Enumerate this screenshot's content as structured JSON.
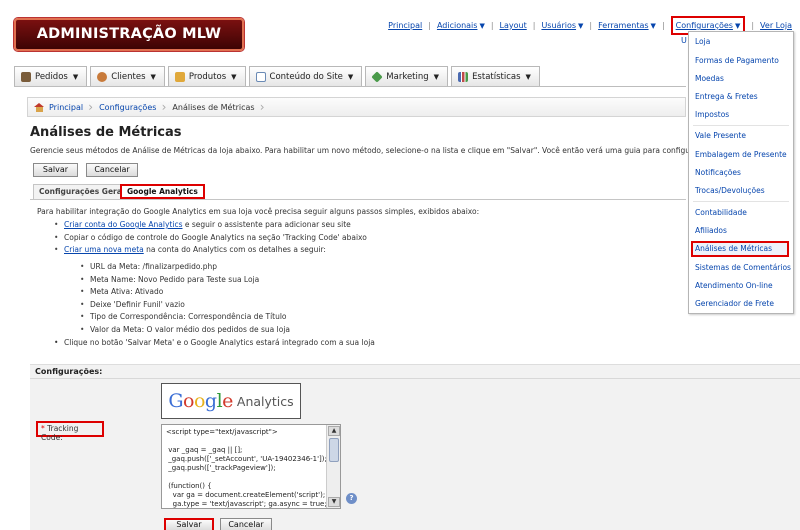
{
  "logo": {
    "text": "ADMINISTRAÇÃO MLW"
  },
  "top_links": [
    {
      "label": "Principal",
      "caret": false
    },
    {
      "label": "Adicionais",
      "caret": true
    },
    {
      "label": "Layout",
      "caret": false
    },
    {
      "label": "Usuários",
      "caret": true
    },
    {
      "label": "Ferramentas",
      "caret": true
    },
    {
      "label": "Configurações",
      "caret": true
    },
    {
      "label": "Ver Loja",
      "caret": false
    }
  ],
  "top_stub": "U",
  "menu_tabs": [
    {
      "label": "Pedidos",
      "icon": "pedidos-icon",
      "color": "#7a5c3a"
    },
    {
      "label": "Clientes",
      "icon": "clientes-icon",
      "color": "#c87a3a"
    },
    {
      "label": "Produtos",
      "icon": "produtos-icon",
      "color": "#e0a83a"
    },
    {
      "label": "Conteúdo do Site",
      "icon": "conteudo-icon",
      "color": "#6a8ab5"
    },
    {
      "label": "Marketing",
      "icon": "marketing-icon",
      "color": "#4a9a4a"
    },
    {
      "label": "Estatísticas",
      "icon": "estatisticas-icon",
      "color": "#4a6ab0"
    }
  ],
  "breadcrumb": [
    {
      "label": "Principal"
    },
    {
      "label": "Configurações"
    },
    {
      "label": "Análises de Métricas"
    }
  ],
  "page": {
    "title": "Análises de Métricas",
    "description": "Gerencie seus métodos de Análise de Métricas da loja abaixo. Para habilitar um novo método, selecione-o na lista e clique em \"Salvar\". Você então verá uma guia para configurá-lo.",
    "save_label": "Salvar",
    "cancel_label": "Cancelar"
  },
  "sub_tabs": [
    {
      "label": "Configurações Gerais"
    },
    {
      "label": "Google Analytics"
    }
  ],
  "instructions": {
    "intro": "Para habilitar integração do Google Analytics em sua loja você precisa seguir alguns passos simples, exibidos abaixo:",
    "step1_link": "Criar conta do Google Analytics",
    "step1_rest": " e seguir o assistente para adicionar seu site",
    "step2": "Copiar o código de controle do Google Analytics na seção 'Tracking Code' abaixo",
    "step3_link": "Criar uma nova meta",
    "step3_rest": " na conta do Analytics com os detalhes a seguir:",
    "details": [
      "URL da Meta: /finalizarpedido.php",
      "Meta Name: Novo Pedido para Teste sua Loja",
      "Meta Ativa: Ativado",
      "Deixe 'Definir Funil' vazio",
      "Tipo de Correspondência: Correspondência de Título",
      "Valor da Meta: O valor médio dos pedidos de sua loja"
    ],
    "final": "Clique no botão 'Salvar Meta' e o Google Analytics estará integrado com a sua loja"
  },
  "config": {
    "heading": "Configurações:",
    "logo_google": "Google",
    "logo_analytics": "Analytics",
    "tracking_label": "Tracking Code:",
    "required_mark": "*",
    "code": "<script type=\"text/javascript\">\n\n var _gaq = _gaq || [];\n _gaq.push(['_setAccount', 'UA-19402346-1']);\n _gaq.push(['_trackPageview']);\n\n (function() {\n   var ga = document.createElement('script');\n   ga.type = 'text/javascript'; ga.async = true;",
    "help": "?",
    "save_label": "Salvar",
    "cancel_label": "Cancelar"
  },
  "dropdown": {
    "items": [
      "Loja",
      "Formas de Pagamento",
      "Moedas",
      "Entrega & Fretes",
      "Impostos",
      "Vale Presente",
      "Embalagem de Presente",
      "Notificações",
      "Trocas/Devoluções",
      "Contabilidade",
      "Afiliados",
      "Análises de Métricas",
      "Sistemas de Comentários",
      "Atendimento On-line",
      "Gerenciador de Frete"
    ],
    "highlighted": "Análises de Métricas"
  },
  "colors": {
    "link": "#0645ad",
    "highlight_border": "#dd0000",
    "logo_bg": "#5a0a0a"
  }
}
